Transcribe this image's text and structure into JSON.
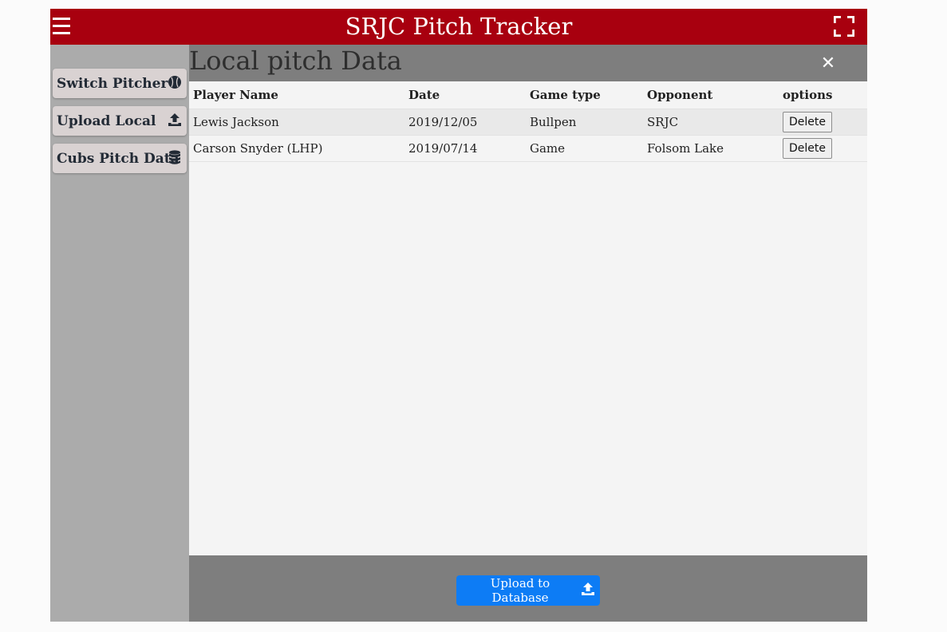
{
  "header": {
    "title": "SRJC Pitch Tracker",
    "menu_icon": "hamburger-icon",
    "fullscreen_icon": "fullscreen-icon"
  },
  "sidebar": {
    "items": [
      {
        "label": "Switch Pitcher",
        "icon": "baseball-icon"
      },
      {
        "label": "Upload Local",
        "icon": "upload-icon"
      },
      {
        "label": "Cubs Pitch Data",
        "icon": "database-icon"
      }
    ]
  },
  "panel": {
    "title": "Local pitch Data",
    "close_symbol": "✕",
    "columns": [
      "Player Name",
      "Date",
      "Game type",
      "Opponent",
      "options"
    ],
    "rows": [
      {
        "name": "Lewis Jackson",
        "date": "2019/12/05",
        "type": "Bullpen",
        "opponent": "SRJC",
        "action": "Delete"
      },
      {
        "name": "Carson Snyder (LHP)",
        "date": "2019/07/14",
        "type": "Game",
        "opponent": "Folsom Lake",
        "action": "Delete"
      }
    ],
    "upload_button": "Upload to Database"
  },
  "colors": {
    "header_red": "#a8000f",
    "sidebar_gray": "#ababab",
    "panel_bar_gray": "#7e7e7e",
    "button_blue": "#0d7cf5",
    "sidebar_button": "#d9d2d2"
  }
}
